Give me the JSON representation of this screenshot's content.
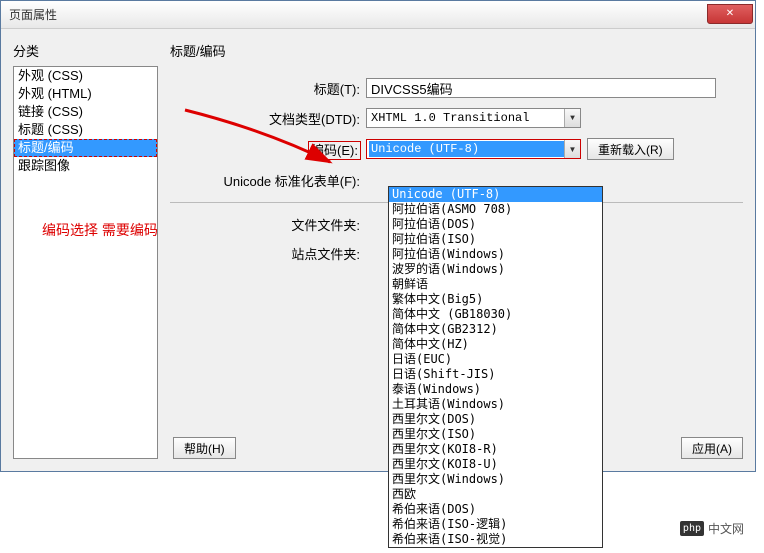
{
  "window": {
    "title": "页面属性"
  },
  "sidebar": {
    "label": "分类",
    "items": [
      {
        "label": "外观 (CSS)"
      },
      {
        "label": "外观 (HTML)"
      },
      {
        "label": "链接 (CSS)"
      },
      {
        "label": "标题 (CSS)"
      },
      {
        "label": "标题/编码"
      },
      {
        "label": "跟踪图像"
      }
    ],
    "selected_index": 4
  },
  "main": {
    "title": "标题/编码",
    "title_label": "标题(T):",
    "title_value": "DIVCSS5编码",
    "doctype_label": "文档类型(DTD):",
    "doctype_value": "XHTML 1.0 Transitional",
    "encoding_label": "编码(E):",
    "encoding_value": "Unicode (UTF-8)",
    "reload_btn": "重新载入(R)",
    "normalize_label": "Unicode 标准化表单(F):",
    "file_folder_label": "文件文件夹:",
    "site_folder_label": "站点文件夹:"
  },
  "dropdown": {
    "items": [
      "Unicode (UTF-8)",
      "阿拉伯语(ASMO 708)",
      "阿拉伯语(DOS)",
      "阿拉伯语(ISO)",
      "阿拉伯语(Windows)",
      "波罗的语(Windows)",
      "朝鲜语",
      "繁体中文(Big5)",
      "简体中文 (GB18030)",
      "简体中文(GB2312)",
      "简体中文(HZ)",
      "日语(EUC)",
      "日语(Shift-JIS)",
      "泰语(Windows)",
      "土耳其语(Windows)",
      "西里尔文(DOS)",
      "西里尔文(ISO)",
      "西里尔文(KOI8-R)",
      "西里尔文(KOI8-U)",
      "西里尔文(Windows)",
      "西欧",
      "希伯来语(DOS)",
      "希伯来语(ISO-逻辑)",
      "希伯来语(ISO-视觉)"
    ],
    "highlight_index": 0
  },
  "buttons": {
    "help": "帮助(H)",
    "apply": "应用(A)"
  },
  "annotation": "编码选择 需要编码",
  "watermark": {
    "logo": "php",
    "text": "中文网"
  }
}
